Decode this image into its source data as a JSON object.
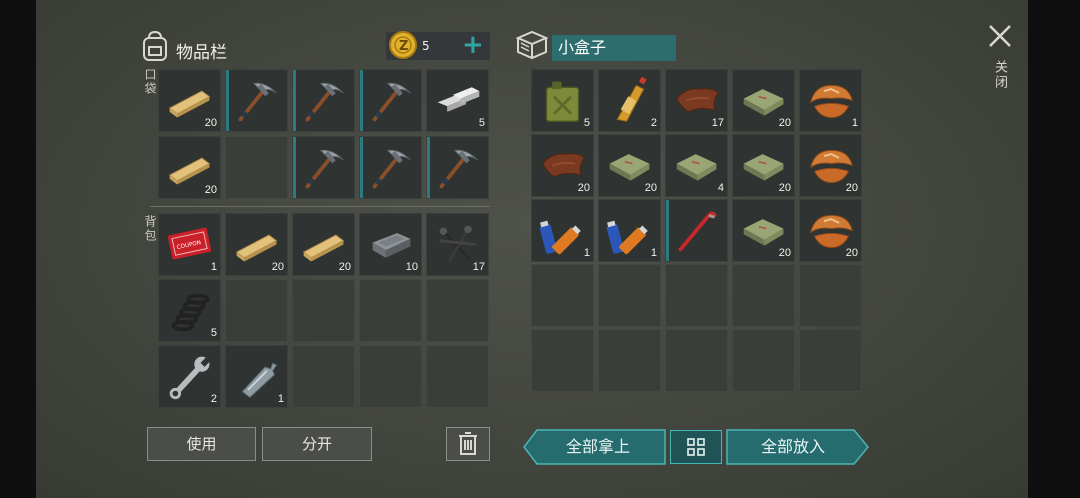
{
  "inventory": {
    "title": "物品栏",
    "pocket_label": "口袋",
    "backpack_label": "背包",
    "coins": "5",
    "add_symbol": "+"
  },
  "box": {
    "title": "小盒子"
  },
  "close": {
    "symbol": "✕",
    "label": "关闭"
  },
  "buttons": {
    "use": "使用",
    "split": "分开",
    "take_all": "全部拿上",
    "put_all": "全部放入"
  },
  "pocket": [
    {
      "item": "plank",
      "count": "20"
    },
    {
      "item": "pickaxe",
      "count": ""
    },
    {
      "item": "pickaxe",
      "count": ""
    },
    {
      "item": "pickaxe",
      "count": ""
    },
    {
      "item": "metal-bars",
      "count": "5"
    },
    {
      "item": "plank",
      "count": "20"
    },
    {
      "item": "empty",
      "count": ""
    },
    {
      "item": "pickaxe",
      "count": ""
    },
    {
      "item": "pickaxe",
      "count": ""
    },
    {
      "item": "pickaxe",
      "count": ""
    }
  ],
  "backpack": [
    {
      "item": "coupon",
      "count": "1",
      "text": "COMBAT GEAR COUPON"
    },
    {
      "item": "plank",
      "count": "20"
    },
    {
      "item": "plank",
      "count": "20"
    },
    {
      "item": "iron-ingot",
      "count": "10"
    },
    {
      "item": "nails",
      "count": "17"
    },
    {
      "item": "spring",
      "count": "5"
    },
    {
      "item": "empty",
      "count": ""
    },
    {
      "item": "empty",
      "count": ""
    },
    {
      "item": "empty",
      "count": ""
    },
    {
      "item": "empty",
      "count": ""
    },
    {
      "item": "wrench",
      "count": "2"
    },
    {
      "item": "bottle",
      "count": "1"
    },
    {
      "item": "empty",
      "count": ""
    },
    {
      "item": "empty",
      "count": ""
    },
    {
      "item": "empty",
      "count": ""
    }
  ],
  "box_items": [
    {
      "item": "jerrycan",
      "count": "5"
    },
    {
      "item": "fuel-bottle",
      "count": "2"
    },
    {
      "item": "leather",
      "count": "17"
    },
    {
      "item": "cloth",
      "count": "20"
    },
    {
      "item": "mushroom",
      "count": "1"
    },
    {
      "item": "leather",
      "count": "20"
    },
    {
      "item": "cloth",
      "count": "20"
    },
    {
      "item": "cloth",
      "count": "4"
    },
    {
      "item": "cloth",
      "count": "20"
    },
    {
      "item": "mushroom",
      "count": "20"
    },
    {
      "item": "batteries",
      "count": "1"
    },
    {
      "item": "batteries",
      "count": "1"
    },
    {
      "item": "crowbar",
      "count": ""
    },
    {
      "item": "cloth",
      "count": "20"
    },
    {
      "item": "mushroom",
      "count": "20"
    },
    {
      "item": "empty",
      "count": ""
    },
    {
      "item": "empty",
      "count": ""
    },
    {
      "item": "empty",
      "count": ""
    },
    {
      "item": "empty",
      "count": ""
    },
    {
      "item": "empty",
      "count": ""
    },
    {
      "item": "empty",
      "count": ""
    },
    {
      "item": "empty",
      "count": ""
    },
    {
      "item": "empty",
      "count": ""
    },
    {
      "item": "empty",
      "count": ""
    },
    {
      "item": "empty",
      "count": ""
    }
  ],
  "colors": {
    "accent_teal": "#2d7a82",
    "slot_bg": "#2f3331",
    "coin_gold": "#e0b22c"
  }
}
